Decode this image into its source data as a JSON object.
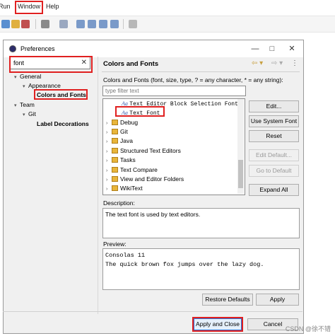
{
  "menubar": {
    "items": [
      "Run",
      "Window",
      "Help"
    ]
  },
  "dialog": {
    "title": "Preferences",
    "minimize": "—",
    "maximize": "□",
    "close": "✕"
  },
  "filter": {
    "value": "font",
    "clear": "✕"
  },
  "tree": [
    {
      "label": "General",
      "indent": 1,
      "twisty": "▾"
    },
    {
      "label": "Appearance",
      "indent": 2,
      "twisty": "▾"
    },
    {
      "label": "Colors and Fonts",
      "indent": 3,
      "twisty": ""
    },
    {
      "label": "Team",
      "indent": 1,
      "twisty": "▾"
    },
    {
      "label": "Git",
      "indent": 2,
      "twisty": "▾"
    },
    {
      "label": "Label Decorations",
      "indent": 3,
      "twisty": ""
    }
  ],
  "page": {
    "title": "Colors and Fonts",
    "description": "Colors and Fonts (font, size, type, ? = any character, * = any string):",
    "type_filter_placeholder": "type filter text",
    "list": [
      {
        "label": "Text Editor Block Selection Font",
        "kind": "font"
      },
      {
        "label": "Text Font",
        "kind": "font"
      },
      {
        "label": "Debug",
        "kind": "folder"
      },
      {
        "label": "Git",
        "kind": "folder"
      },
      {
        "label": "Java",
        "kind": "folder"
      },
      {
        "label": "Structured Text Editors",
        "kind": "folder"
      },
      {
        "label": "Tasks",
        "kind": "folder"
      },
      {
        "label": "Text Compare",
        "kind": "folder"
      },
      {
        "label": "View and Editor Folders",
        "kind": "folder"
      },
      {
        "label": "WikiText",
        "kind": "folder"
      }
    ],
    "buttons": {
      "edit": "Edit...",
      "use_system_font": "Use System Font",
      "reset": "Reset",
      "edit_default": "Edit Default...",
      "go_to_default": "Go to Default",
      "expand_all": "Expand All"
    },
    "description_label": "Description:",
    "font_description": "The text font is used by text editors.",
    "preview_label": "Preview:",
    "preview_lines": [
      "Consolas 11",
      "The quick brown fox jumps over the lazy dog."
    ],
    "restore_defaults": "Restore Defaults",
    "apply": "Apply"
  },
  "footer": {
    "apply_and_close": "Apply and Close",
    "cancel": "Cancel"
  },
  "watermark": "CSDN @徐不错",
  "colors": {
    "highlight": "#e02020",
    "selection": "#0078d7"
  }
}
